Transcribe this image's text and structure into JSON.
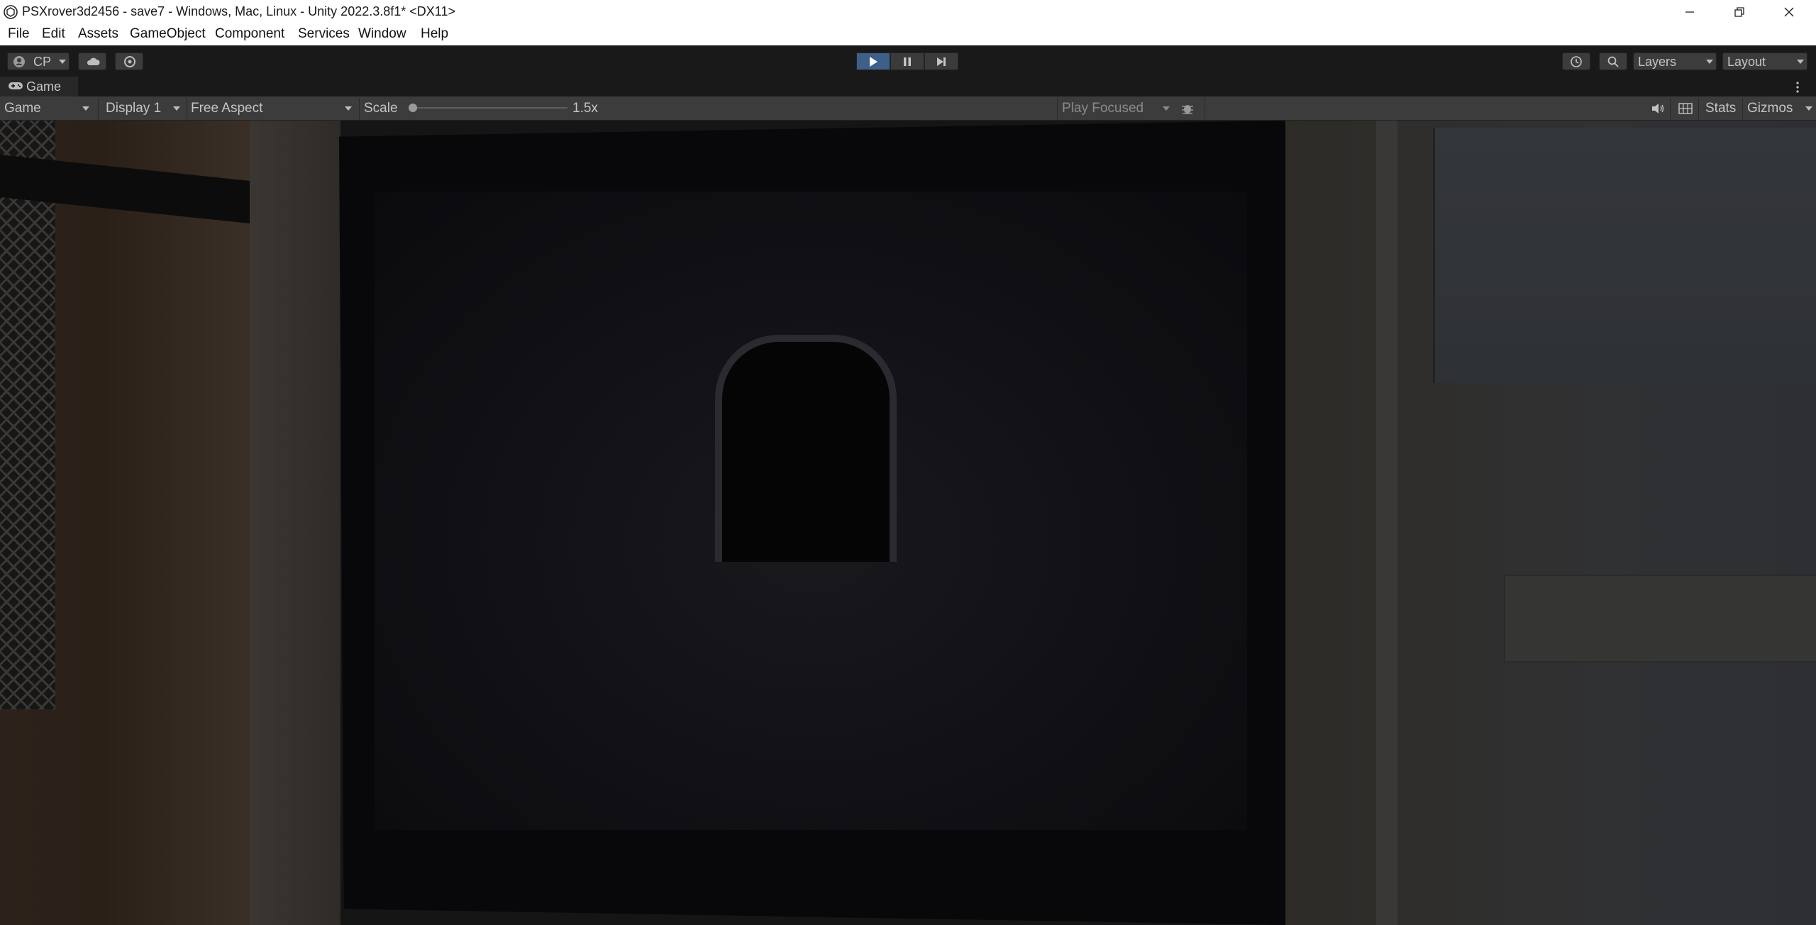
{
  "window": {
    "title": "PSXrover3d2456 - save7 - Windows, Mac, Linux - Unity 2022.3.8f1* <DX11>"
  },
  "menu": [
    "File",
    "Edit",
    "Assets",
    "GameObject",
    "Component",
    "Services",
    "Window",
    "Help"
  ],
  "toolbar": {
    "account_label": "CP",
    "layers_label": "Layers",
    "layout_label": "Layout",
    "play_state": "playing"
  },
  "tab": {
    "label": "Game"
  },
  "gamebar": {
    "view_mode": "Game",
    "display": "Display 1",
    "aspect": "Free Aspect",
    "scale_label": "Scale",
    "scale_value": "1.5x",
    "scale_fraction": 0.0,
    "play_mode": "Play Focused",
    "stats_label": "Stats",
    "gizmos_label": "Gizmos"
  },
  "colors": {
    "editor_bg": "#191919",
    "toolbar_btn": "#3c3c3c",
    "play_active": "#3e5f8a",
    "control_strip": "#3c3c3c",
    "title_bar": "#ffffff"
  },
  "icons": [
    "unity-logo-icon",
    "minimize-icon",
    "restore-icon",
    "close-icon",
    "account-icon",
    "cloud-icon",
    "collab-icon",
    "play-icon",
    "pause-icon",
    "step-icon",
    "history-icon",
    "search-icon",
    "gamepad-icon",
    "kebab-icon",
    "bug-icon",
    "audio-icon",
    "grid-icon"
  ]
}
